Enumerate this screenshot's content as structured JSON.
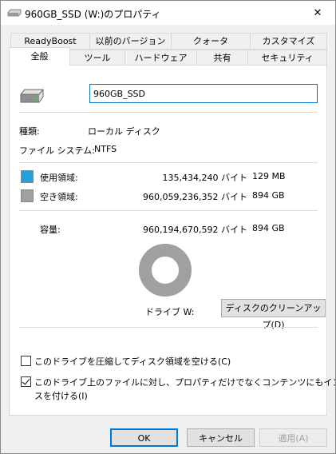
{
  "window": {
    "title": "960GB_SSD (W:)のプロパティ",
    "close_glyph": "✕"
  },
  "tabs_back": [
    "ReadyBoost",
    "以前のバージョン",
    "クォータ",
    "カスタマイズ"
  ],
  "tabs_front": [
    "全般",
    "ツール",
    "ハードウェア",
    "共有",
    "セキュリティ"
  ],
  "active_tab": "全般",
  "general": {
    "volume_name": "960GB_SSD",
    "type_label": "種類:",
    "type_value": "ローカル ディスク",
    "fs_label": "ファイル システム:",
    "fs_value": "NTFS",
    "used_label": "使用領域:",
    "used_bytes": "135,434,240 バイト",
    "used_size": "129 MB",
    "free_label": "空き領域:",
    "free_bytes": "960,059,236,352 バイト",
    "free_size": "894 GB",
    "capacity_label": "容量:",
    "capacity_bytes": "960,194,670,592 バイト",
    "capacity_size": "894 GB",
    "drive_label": "ドライブ W:",
    "cleanup_button": "ディスクのクリーンアップ(D)",
    "compress_label": "このドライブを圧縮してディスク領域を空ける(C)",
    "compress_checked": false,
    "index_label_line1": "このドライブ上のファイルに対し、プロパティだけでなくコンテンツにもインデック",
    "index_label_line2": "スを付ける(I)",
    "index_checked": true,
    "used_fraction": 0.000141
  },
  "colors": {
    "used": "#26a0da",
    "free": "#a0a0a0",
    "accent": "#0078d7"
  },
  "buttons": {
    "ok": "OK",
    "cancel": "キャンセル",
    "apply": "適用(A)"
  }
}
